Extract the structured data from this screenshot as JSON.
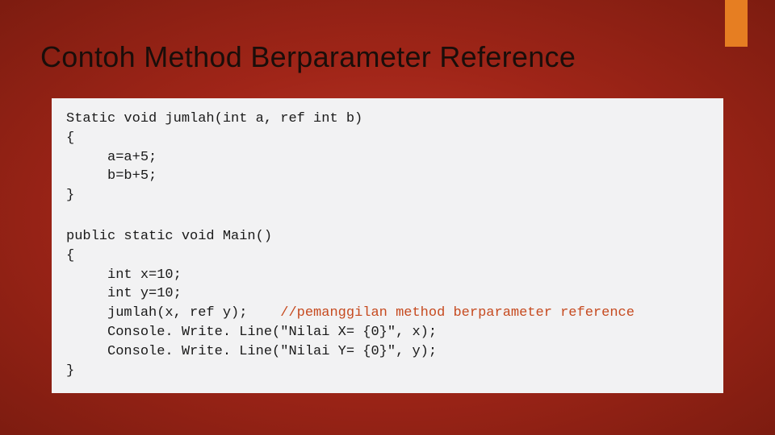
{
  "slide": {
    "title": "Contoh Method Berparameter Reference"
  },
  "code1": {
    "l1": "Static void jumlah(int a, ref int b)",
    "l2": "{",
    "l3": "     a=a+5;",
    "l4": "     b=b+5;",
    "l5": "}"
  },
  "code2": {
    "l1": "public static void Main()",
    "l2": "{",
    "l3": "     int x=10;",
    "l4": "     int y=10;",
    "l5a": "     jumlah(x, ref y);    ",
    "l5b": "//pemanggilan method berparameter reference",
    "l6": "     Console. Write. Line(\"Nilai X= {0}\", x);",
    "l7": "     Console. Write. Line(\"Nilai Y= {0}\", y);",
    "l8": "}"
  }
}
